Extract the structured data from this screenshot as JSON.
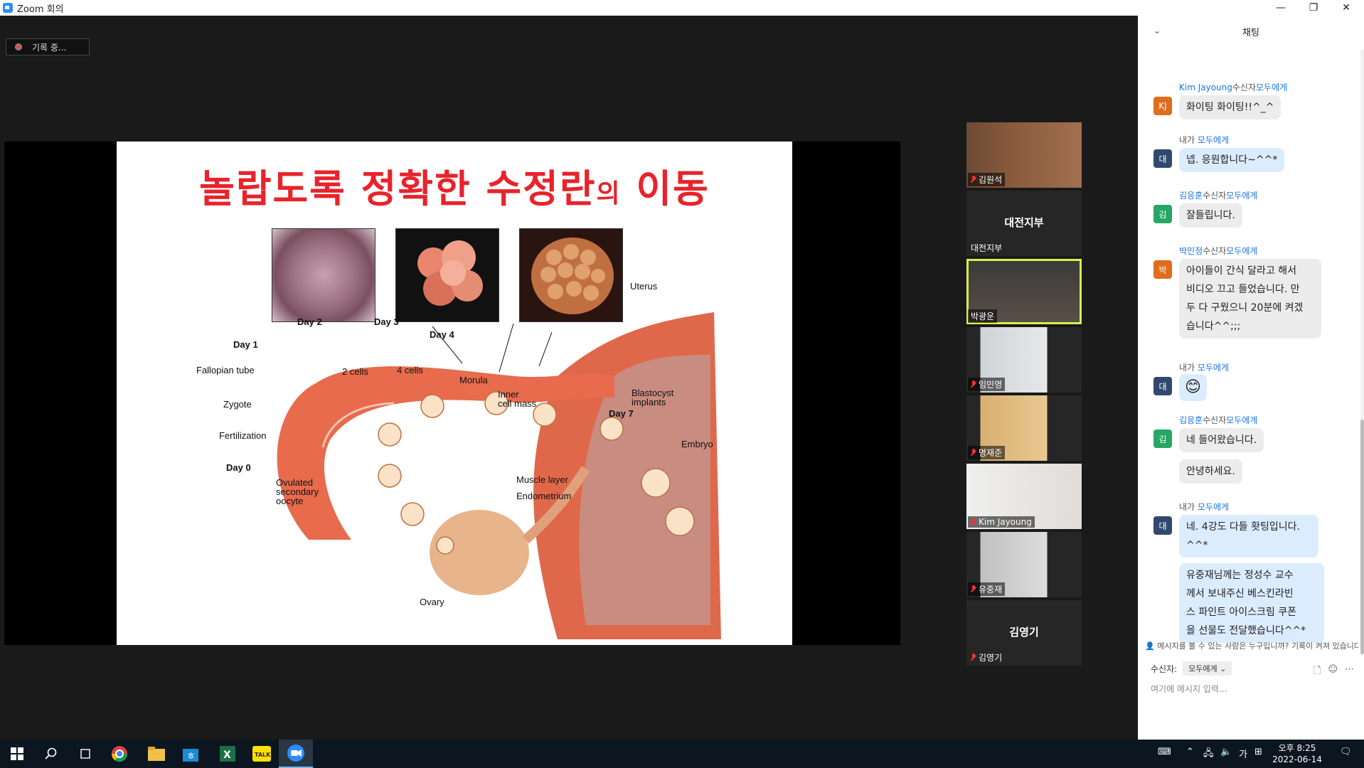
{
  "window": {
    "title": "Zoom 회의",
    "min": "—",
    "restore": "❐",
    "close": "✕"
  },
  "recording": {
    "label": "기록 중..."
  },
  "slide": {
    "title_part1": "놀랍도록 정확한 수정란",
    "title_part2": "의",
    "title_part3": " 이동",
    "labels": {
      "day0": "Day 0",
      "day1": "Day 1",
      "day2": "Day 2",
      "day3": "Day 3",
      "day4": "Day 4",
      "day7": "Day 7",
      "fallopian": "Fallopian tube",
      "zygote": "Zygote",
      "fertilization": "Fertilization",
      "ovulated1": "Ovulated",
      "ovulated2": "secondary",
      "ovulated3": "oocyte",
      "cells2": "2 cells",
      "cells4": "4 cells",
      "morula": "Morula",
      "inner1": "Inner",
      "inner2": "cell mass",
      "blasto1": "Blastocyst",
      "blasto2": "implants",
      "embryo": "Embryo",
      "uterus": "Uterus",
      "muscle": "Muscle layer",
      "endometrium": "Endometrium",
      "ovary": "Ovary"
    }
  },
  "participants": [
    {
      "name": "김원석",
      "type": "video"
    },
    {
      "name": "대전지부",
      "big": "대전지부",
      "type": "label"
    },
    {
      "name": "박광운",
      "type": "video",
      "active": true
    },
    {
      "name": "임민영",
      "type": "video"
    },
    {
      "name": "명재준",
      "type": "video"
    },
    {
      "name": "Kim Jayoung",
      "type": "video"
    },
    {
      "name": "유중재",
      "type": "video"
    },
    {
      "name": "김영기",
      "big": "김영기",
      "type": "label"
    }
  ],
  "chat": {
    "title": "채팅",
    "messages": [
      {
        "sender": "Kim Jayoung",
        "mid": "수신자",
        "to": "모두에게",
        "avatar": "KJ",
        "color": "#e06c1d",
        "texts": [
          "화이팅 화이팅!!^_^"
        ]
      },
      {
        "sender": "내가",
        "mid": " ",
        "to": "모두에게",
        "avatar": "대",
        "color": "#2f4a6e",
        "me": true,
        "texts": [
          "넵. 응원합니다~^^*"
        ]
      },
      {
        "sender": "김응훈",
        "mid": "수신자",
        "to": "모두에게",
        "avatar": "김",
        "color": "#27a664",
        "texts": [
          "잘들립니다."
        ]
      },
      {
        "sender": "박민정",
        "mid": "수신자",
        "to": "모두에게",
        "avatar": "박",
        "color": "#e06c1d",
        "texts": [
          "아이들이 간식 달라고 해서",
          "비디오 끄고 들었습니다. 만",
          "두 다 구웠으니 20분에 켜겠",
          "습니다^^;;;"
        ]
      },
      {
        "sender": "내가",
        "mid": " ",
        "to": "모두에게",
        "avatar": "대",
        "color": "#2f4a6e",
        "me": true,
        "emoji": "😊"
      },
      {
        "sender": "김응훈",
        "mid": "수신자",
        "to": "모두에게",
        "avatar": "김",
        "color": "#27a664",
        "texts": [
          "네 들어왔습니다."
        ],
        "extra": [
          "안녕하세요."
        ]
      },
      {
        "sender": "내가",
        "mid": " ",
        "to": "모두에게",
        "avatar": "대",
        "color": "#2f4a6e",
        "me": true,
        "texts": [
          "네. 4강도 다들 홧팅입니다.",
          "^^*"
        ],
        "extra": [
          "유중재님께는 정성수 교수",
          "께서 보내주신 베스킨라빈",
          "스 파인트 아이스크림 쿠폰",
          "을 선물도 전달했습니다^^*"
        ]
      }
    ],
    "notice": "메시지를 볼 수 있는 사람은 누구입니까? 기록이 켜져 있습니다",
    "to_label": "수신자:",
    "to_value": "모두에게",
    "input_placeholder": "여기에 메시지 입력..."
  },
  "taskbar": {
    "time": "오후 8:25",
    "date": "2022-06-14",
    "ime": "가"
  }
}
